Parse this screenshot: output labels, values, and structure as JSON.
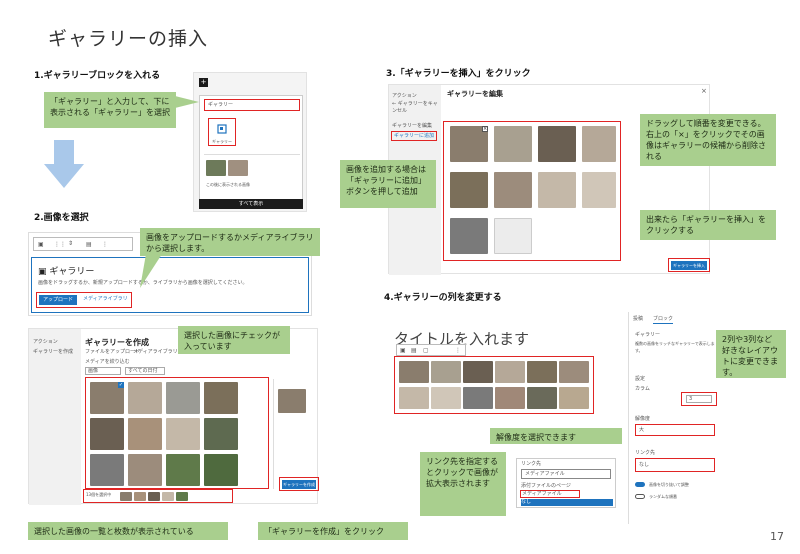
{
  "page": {
    "title": "ギャラリーの挿入",
    "page_number": "17"
  },
  "step1": {
    "heading": "1.ギャラリーブロックを入れる",
    "callout": "「ギャラリー」と入力して、下に表示される「ギャラリー」を選択",
    "search_value": "ギャラリー",
    "block_label": "ギャラリー",
    "footer_text": "すべて表示",
    "caption": "この後に表示される画像"
  },
  "step2": {
    "heading": "2.画像を選択",
    "callout": "画像をアップロードするかメディアライブラリから選択します。",
    "block_title": "ギャラリー",
    "description": "画像をドラッグするか、新規アップロードするか、ライブラリから画像を選択してください。",
    "upload_button": "アップロード",
    "library_link": "メディアライブラリ"
  },
  "step2b": {
    "dialog_title": "ギャラリーを作成",
    "sidebar_action": "アクション",
    "sidebar_item": "ギャラリーを作成",
    "tab_upload": "ファイルをアップロード",
    "tab_library": "メディアライブラリ",
    "filter_label": "メディアを絞り込む",
    "filter_value": "画像",
    "date_value": "すべての日付",
    "callout_checked": "選択した画像にチェックが入っています",
    "callout_selected": "選択した画像の一覧と枚数が表示されている",
    "callout_create": "「ギャラリーを作成」をクリック",
    "selected_count": "13個を選択中",
    "create_button": "ギャラリーを作成"
  },
  "step3": {
    "heading": "3.「ギャラリーを挿入」をクリック",
    "dialog_title": "ギャラリーを編集",
    "sidebar_action": "アクション",
    "sidebar_cancel": "← ギャラリーをキャンセル",
    "sidebar_edit": "ギャラリーを編集",
    "sidebar_add": "ギャラリーに追加",
    "callout_drag": "ドラッグして順番を変更できる。右上の「×」をクリックでその画像はギャラリーの候補から削除される",
    "callout_add": "画像を追加する場合は「ギャラリーに追加」ボタンを押して追加",
    "callout_insert": "出来たら「ギャラリーを挿入」をクリックする",
    "insert_button": "ギャラリーを挿入"
  },
  "step4": {
    "heading": "4.ギャラリーの列を変更する",
    "title_placeholder": "タイトルを入れます",
    "tab_post": "投稿",
    "tab_block": "ブロック",
    "block_name": "ギャラリー",
    "block_desc": "複数の画像をリッチなギャラリーで表示します。",
    "settings_label": "設定",
    "columns_label": "カラム",
    "columns_value": "3",
    "resolution_label": "解像度",
    "resolution_value": "大",
    "link_label": "リンク先",
    "link_value": "なし",
    "crop_label": "画像を切り抜いて調整",
    "random_label": "ランダムな順番",
    "callout_columns": "2列や3列など好きなレイアウトに変更できます。",
    "callout_resolution": "解像度を選択できます",
    "callout_link": "リンク先を指定するとクリックで画像が拡大表示されます",
    "dropdown_value": "メディアファイル",
    "dropdown_options": [
      "添付ファイルのページ",
      "メディアファイル",
      "なし"
    ],
    "link_field_label": "リンク先"
  },
  "colors": {
    "callout": "#a9cf8e",
    "highlight": "#e02424",
    "accent": "#1e73be"
  }
}
